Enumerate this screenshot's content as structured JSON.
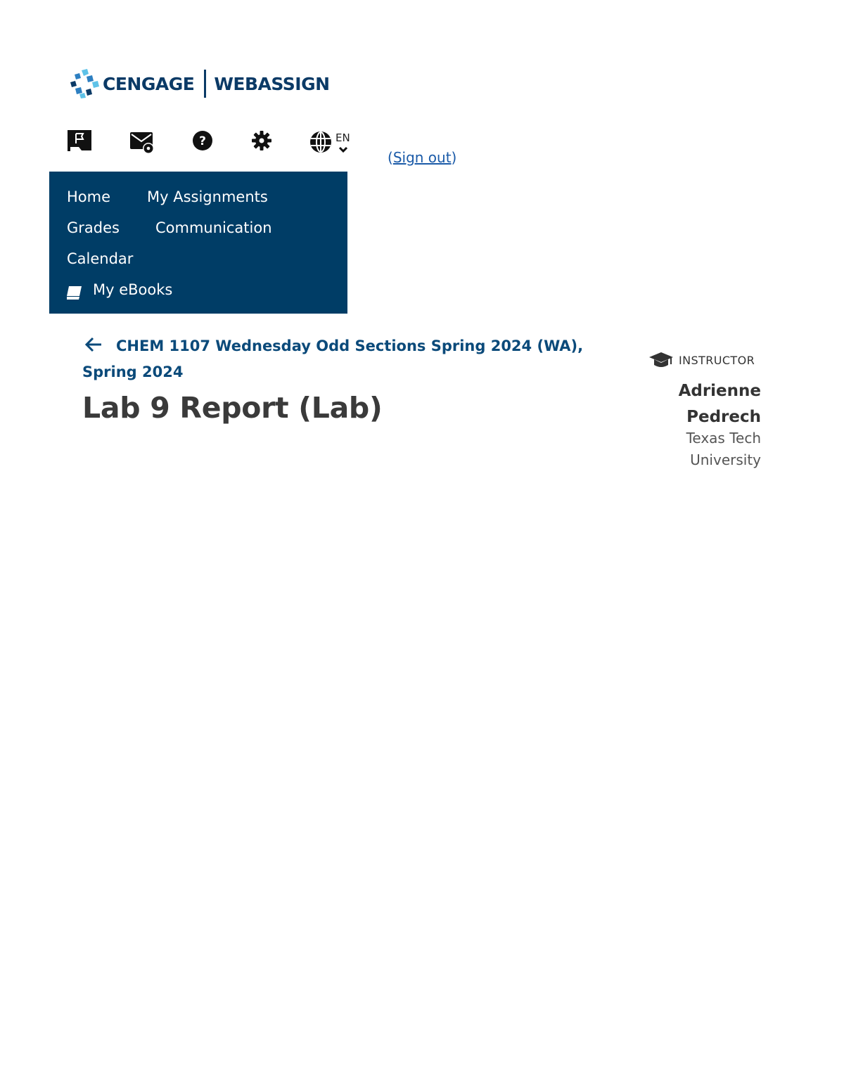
{
  "brand": {
    "primary_name": "CENGAGE",
    "product_name": "WEBASSIGN",
    "color": "#0b3a66"
  },
  "toolbar": {
    "icons": [
      "flag-icon",
      "mail-settings-icon",
      "help-icon",
      "gear-icon",
      "globe-icon"
    ],
    "language_code": "EN",
    "sign_out_prefix": "(",
    "sign_out_label": "Sign out",
    "sign_out_suffix": ")"
  },
  "nav": {
    "background": "#003d66",
    "items": [
      {
        "label": "Home"
      },
      {
        "label": "My Assignments"
      },
      {
        "label": "Grades"
      },
      {
        "label": "Communication"
      },
      {
        "label": "Calendar"
      },
      {
        "label": "My eBooks",
        "icon": "book-icon"
      }
    ]
  },
  "course": {
    "back_link": "CHEM 1107 Wednesday Odd Sections Spring 2024 (WA), Spring 2024",
    "link_color": "#0b4a7a"
  },
  "assignment": {
    "title": "Lab 9 Report (Lab)"
  },
  "instructor": {
    "label": "INSTRUCTOR",
    "name": "Adrienne Pedrech",
    "school": "Texas Tech University",
    "icon": "graduation-cap-icon"
  }
}
